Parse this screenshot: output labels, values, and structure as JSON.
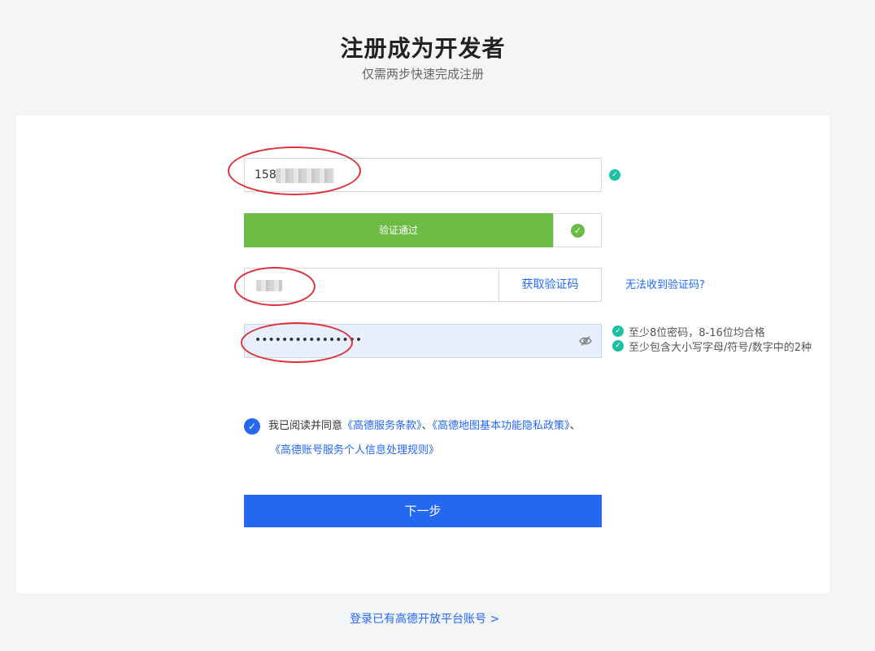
{
  "header": {
    "title": "注册成为开发者",
    "subtitle": "仅需两步快速完成注册"
  },
  "form": {
    "phone": {
      "value_prefix": "158",
      "status_icon": "check-circle-icon",
      "status_color": "#1cc0a3"
    },
    "captcha": {
      "label": "验证通过",
      "status_icon": "check-circle-icon",
      "bar_color": "#6bbb45"
    },
    "sms_code": {
      "get_code_label": "获取验证码",
      "help_link": "无法收到验证码?"
    },
    "password": {
      "masked_value": "••••••••••••••••",
      "toggle_icon": "eye-off-icon",
      "hints": [
        "至少8位密码，8-16位均合格",
        "至少包含大小写字母/符号/数字中的2种"
      ]
    },
    "agreement": {
      "checked": true,
      "prefix": "我已阅读并同意",
      "terms_1": "《高德服务条款》",
      "sep_1": "、",
      "terms_2": "《高德地图基本功能隐私政策》",
      "sep_2": "、",
      "terms_3": "《高德账号服务个人信息处理规则》"
    },
    "next_button": "下一步"
  },
  "footer": {
    "login_link": "登录已有高德开放平台账号 >"
  },
  "colors": {
    "accent": "#2468f2",
    "success": "#6bbb45",
    "annotation": "#e0303a"
  }
}
